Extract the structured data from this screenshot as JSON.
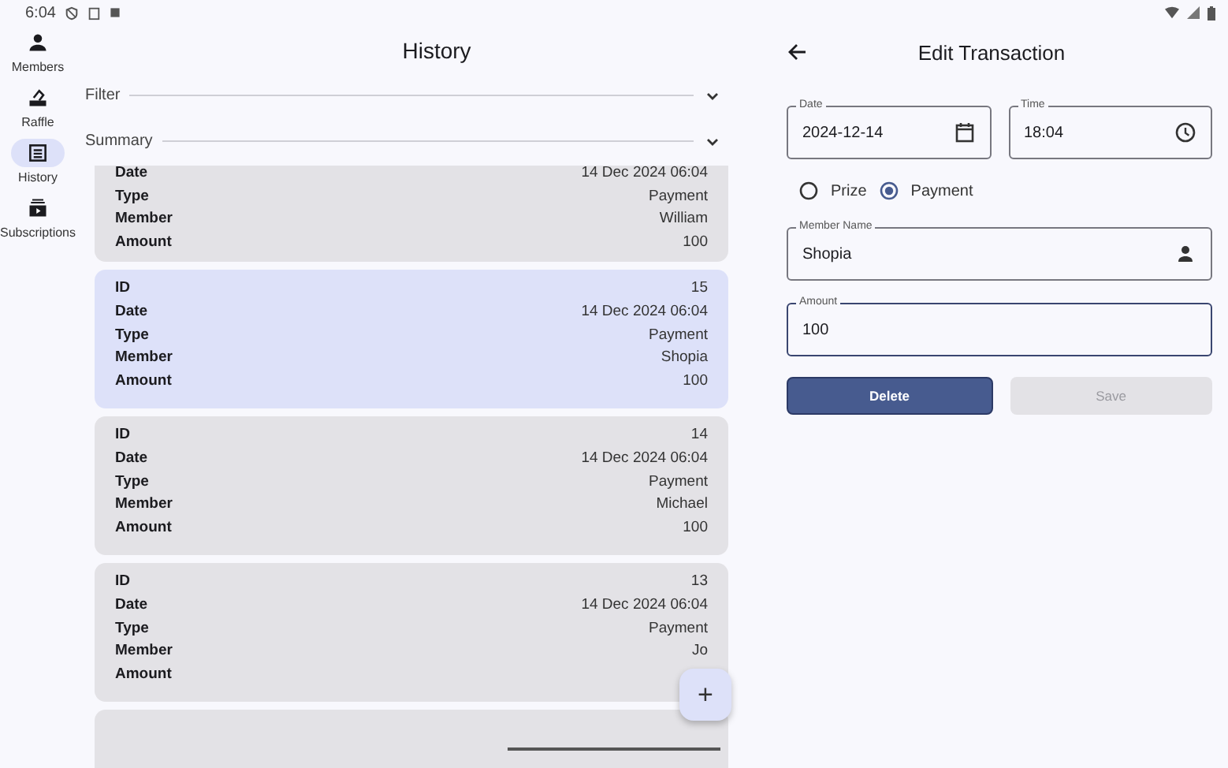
{
  "status_bar": {
    "time": "6:04"
  },
  "nav_rail": {
    "items": [
      {
        "label": "Members",
        "selected": false
      },
      {
        "label": "Raffle",
        "selected": false
      },
      {
        "label": "History",
        "selected": true
      },
      {
        "label": "Subscriptions",
        "selected": false
      }
    ]
  },
  "history": {
    "title": "History",
    "sections": [
      {
        "label": "Filter",
        "expanded": false
      },
      {
        "label": "Summary",
        "expanded": false
      }
    ],
    "cards": [
      {
        "selected": false,
        "rows": [
          {
            "label": "Date",
            "value": "14 Dec 2024 06:04"
          },
          {
            "label": "Type",
            "value": "Payment"
          },
          {
            "label": "Member",
            "value": "William"
          },
          {
            "label": "Amount",
            "value": "100"
          }
        ]
      },
      {
        "selected": true,
        "rows": [
          {
            "label": "ID",
            "value": "15"
          },
          {
            "label": "Date",
            "value": "14 Dec 2024 06:04"
          },
          {
            "label": "Type",
            "value": "Payment"
          },
          {
            "label": "Member",
            "value": "Shopia"
          },
          {
            "label": "Amount",
            "value": "100"
          }
        ]
      },
      {
        "selected": false,
        "rows": [
          {
            "label": "ID",
            "value": "14"
          },
          {
            "label": "Date",
            "value": "14 Dec 2024 06:04"
          },
          {
            "label": "Type",
            "value": "Payment"
          },
          {
            "label": "Member",
            "value": "Michael"
          },
          {
            "label": "Amount",
            "value": "100"
          }
        ]
      },
      {
        "selected": false,
        "rows": [
          {
            "label": "ID",
            "value": "13"
          },
          {
            "label": "Date",
            "value": "14 Dec 2024 06:04"
          },
          {
            "label": "Type",
            "value": "Payment"
          },
          {
            "label": "Member",
            "value": "Jo"
          },
          {
            "label": "Amount"
          }
        ]
      },
      {
        "selected": false
      }
    ],
    "fab": {
      "label": "+"
    }
  },
  "edit": {
    "title": "Edit Transaction",
    "date": {
      "label": "Date",
      "value": "2024-12-14"
    },
    "time": {
      "label": "Time",
      "value": "18:04"
    },
    "type_options": [
      {
        "label": "Prize",
        "selected": false
      },
      {
        "label": "Payment",
        "selected": true
      }
    ],
    "member": {
      "label": "Member Name",
      "value": "Shopia"
    },
    "amount": {
      "label": "Amount",
      "value": "100",
      "focused": true
    },
    "buttons": [
      {
        "label": "Delete",
        "disabled": false,
        "kind": "filled"
      },
      {
        "label": "Save",
        "disabled": true,
        "kind": "filled"
      }
    ]
  }
}
